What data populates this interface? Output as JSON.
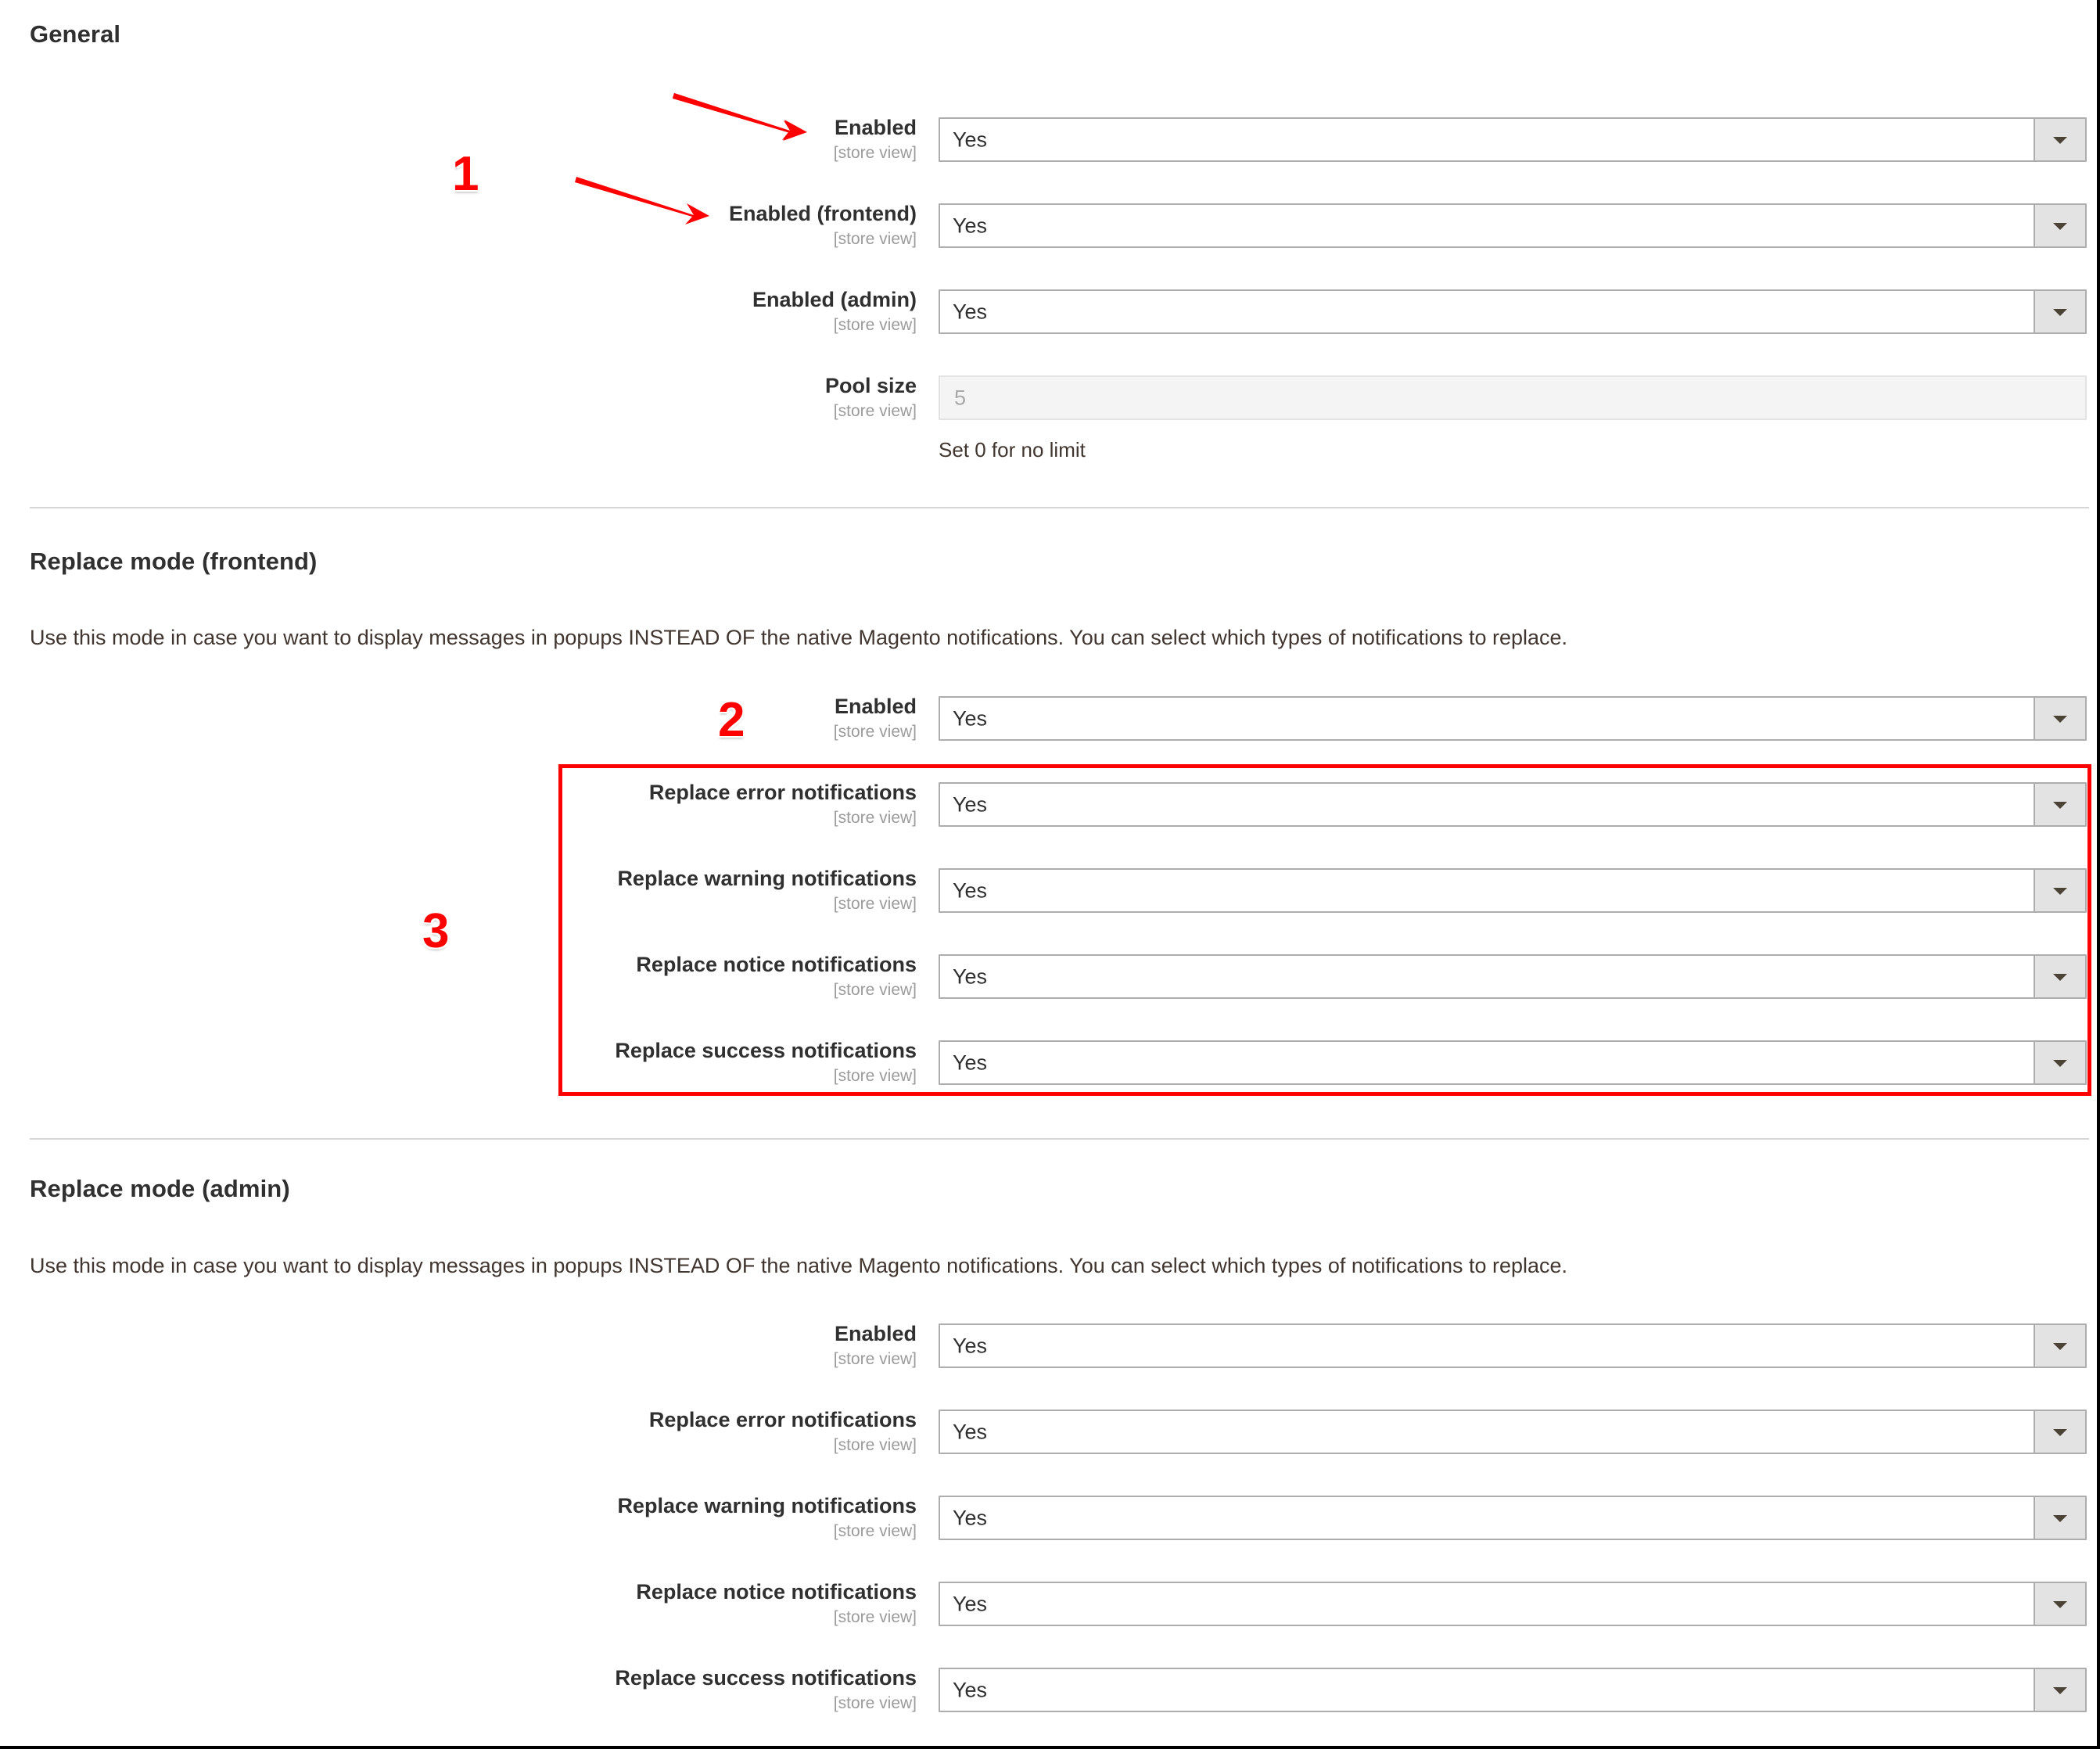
{
  "page": {
    "scope_label": "[store view]",
    "accent_red": "#ff0000",
    "text_color": "#303030"
  },
  "sections": [
    {
      "id": "general",
      "title": "General",
      "description": null,
      "fields": [
        {
          "label": "Enabled",
          "scope": "[store view]",
          "type": "select",
          "value": "Yes",
          "hint": null
        },
        {
          "label": "Enabled (frontend)",
          "scope": "[store view]",
          "type": "select",
          "value": "Yes",
          "hint": null
        },
        {
          "label": "Enabled (admin)",
          "scope": "[store view]",
          "type": "select",
          "value": "Yes",
          "hint": null
        },
        {
          "label": "Pool size",
          "scope": "[store view]",
          "type": "text",
          "value": "5",
          "hint": "Set 0 for no limit"
        }
      ]
    },
    {
      "id": "replace-mode-frontend",
      "title": "Replace mode (frontend)",
      "description": "Use this mode in case you want to display messages in popups INSTEAD OF the native Magento notifications. You can select which types of notifications to replace.",
      "fields": [
        {
          "label": "Enabled",
          "scope": "[store view]",
          "type": "select",
          "value": "Yes",
          "hint": null
        },
        {
          "label": "Replace error notifications",
          "scope": "[store view]",
          "type": "select",
          "value": "Yes",
          "hint": null
        },
        {
          "label": "Replace warning notifications",
          "scope": "[store view]",
          "type": "select",
          "value": "Yes",
          "hint": null
        },
        {
          "label": "Replace notice notifications",
          "scope": "[store view]",
          "type": "select",
          "value": "Yes",
          "hint": null
        },
        {
          "label": "Replace success notifications",
          "scope": "[store view]",
          "type": "select",
          "value": "Yes",
          "hint": null
        }
      ]
    },
    {
      "id": "replace-mode-admin",
      "title": "Replace mode (admin)",
      "description": "Use this mode in case you want to display messages in popups INSTEAD OF the native Magento notifications. You can select which types of notifications to replace.",
      "fields": [
        {
          "label": "Enabled",
          "scope": "[store view]",
          "type": "select",
          "value": "Yes",
          "hint": null
        },
        {
          "label": "Replace error notifications",
          "scope": "[store view]",
          "type": "select",
          "value": "Yes",
          "hint": null
        },
        {
          "label": "Replace warning notifications",
          "scope": "[store view]",
          "type": "select",
          "value": "Yes",
          "hint": null
        },
        {
          "label": "Replace notice notifications",
          "scope": "[store view]",
          "type": "select",
          "value": "Yes",
          "hint": null
        },
        {
          "label": "Replace success notifications",
          "scope": "[store view]",
          "type": "select",
          "value": "Yes",
          "hint": null
        }
      ]
    }
  ],
  "annotations": {
    "markers": [
      {
        "id": "marker-1",
        "text": "1"
      },
      {
        "id": "marker-2",
        "text": "2"
      },
      {
        "id": "marker-3",
        "text": "3"
      }
    ]
  }
}
